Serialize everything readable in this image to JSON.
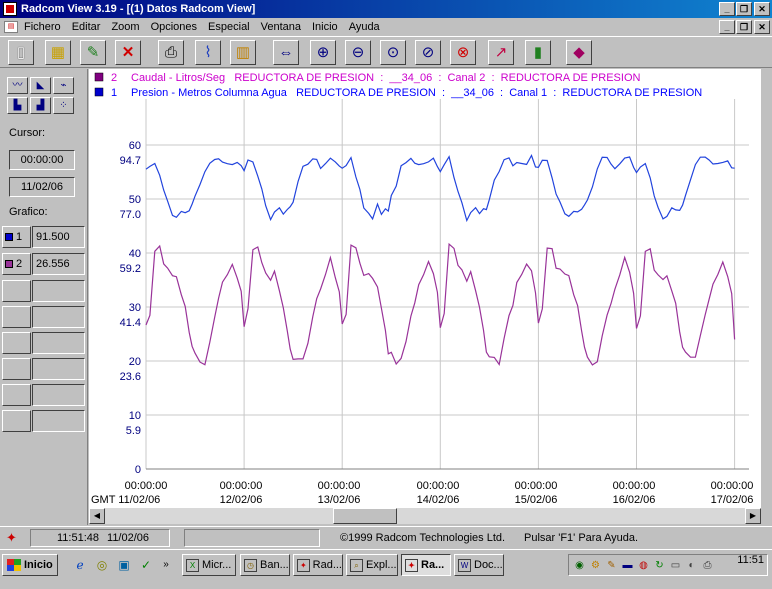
{
  "window": {
    "title": "Radcom View 3.19 - [(1) Datos Radcom View]"
  },
  "menu": [
    "Fichero",
    "Editar",
    "Zoom",
    "Opciones",
    "Especial",
    "Ventana",
    "Inicio",
    "Ayuda"
  ],
  "toolbar": {
    "icons": [
      "new-icon",
      "open-icon",
      "edit-icon",
      "delete-icon",
      "print-icon",
      "chart-icon",
      "export-icon",
      "fit-icon",
      "zoom-in-icon",
      "zoom-out-icon",
      "zoom-box-icon",
      "zoom-prev-icon",
      "zoom-cancel-icon",
      "trend-icon",
      "bar-chart-icon",
      "book-icon"
    ]
  },
  "left_panel": {
    "cursor_label": "Cursor:",
    "cursor_time": "00:00:00",
    "cursor_date": "11/02/06",
    "grafico_label": "Grafico:",
    "channels": [
      {
        "id": "1",
        "value": "91.500",
        "color": "#0000cc"
      },
      {
        "id": "2",
        "value": "26.556",
        "color": "#993399"
      }
    ]
  },
  "chart_data": {
    "type": "line",
    "legend": [
      {
        "num": "2",
        "text": "Caudal - Litros/Seg   REDUCTORA DE PRESION  :  __34_06  :  Canal 2  :  REDUCTORA DE PRESION",
        "color": "#cc00cc",
        "swatch": "#800080"
      },
      {
        "num": "1",
        "text": "Presion - Metros Columna Agua   REDUCTORA DE PRESION  :  __34_06  :  Canal 1  :  REDUCTORA DE PRESION",
        "color": "#0000ff",
        "swatch": "#0000cc"
      }
    ],
    "caudal_ticks": [
      "60",
      "50",
      "40",
      "30",
      "20",
      "10",
      "0"
    ],
    "presion_ticks": [
      "94.7",
      "77.0",
      "59.2",
      "41.4",
      "23.6",
      "5.9"
    ],
    "x_time_labels": [
      "00:00:00",
      "00:00:00",
      "00:00:00",
      "00:00:00",
      "00:00:00",
      "00:00:00",
      "00:00:00"
    ],
    "x_date_labels": [
      "GMT 11/02/06",
      "12/02/06",
      "13/02/06",
      "14/02/06",
      "15/02/06",
      "16/02/06",
      "17/02/06"
    ],
    "presion_color": "#2244dd",
    "caudal_color": "#993399",
    "x_days": [
      0,
      0.04,
      0.09,
      0.14,
      0.18,
      0.22,
      0.27,
      0.31,
      0.36,
      0.4,
      0.44,
      0.47,
      0.5,
      0.55,
      0.6,
      0.65,
      0.7,
      0.74,
      0.78,
      0.83,
      0.88,
      0.93,
      0.97
    ],
    "presion_day_profile": [
      91.5,
      93.5,
      94.7,
      90,
      84,
      80,
      76,
      76.5,
      79,
      78,
      77.5,
      79,
      82,
      87,
      92,
      94.5,
      94.7,
      94,
      93,
      93.5,
      94.2,
      95,
      93
    ],
    "caudal_day_profile": [
      26.556,
      29,
      41,
      41.5,
      37.5,
      36.5,
      35.5,
      36,
      33,
      30.5,
      25,
      22,
      21,
      20,
      20,
      24,
      28,
      31,
      34,
      36,
      38.5,
      36,
      33
    ],
    "days": 6,
    "last_day_fraction": 0.99
  },
  "status_bar": {
    "time": "11:51:48",
    "date": "11/02/06",
    "copyright": "©1999 Radcom Technologies Ltd.",
    "help": "Pulsar 'F1' Para Ayuda."
  },
  "taskbar": {
    "start": "Inicio",
    "tasks": [
      "Micr...",
      "Ban...",
      "Rad...",
      "Expl...",
      "Ra...",
      "Doc..."
    ],
    "clock": "11:51"
  }
}
